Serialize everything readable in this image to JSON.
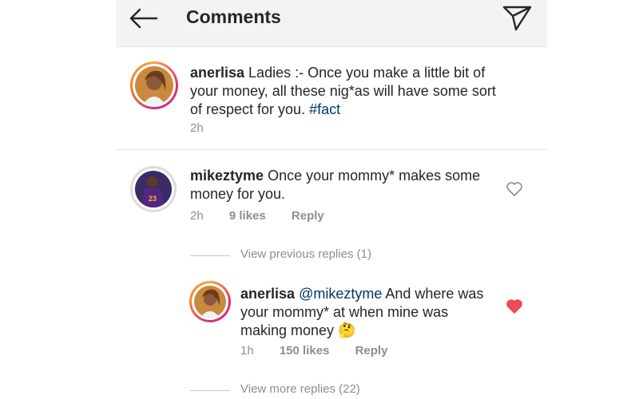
{
  "header": {
    "title": "Comments",
    "back_icon": "arrow-left-icon",
    "send_icon": "paper-plane-icon"
  },
  "caption": {
    "username": "anerlisa",
    "text_line1": " Ladies :- Once you make a little bit of",
    "text_line2": "your money, all these nig*as will have some sort",
    "text_line3_prefix": "of respect for you. ",
    "hashtag": "#fact",
    "time": "2h"
  },
  "comment1": {
    "username": "mikeztyme",
    "text_line1": " Once your mommy* makes some",
    "text_line2": "money for you.",
    "time": "2h",
    "likes": "9 likes",
    "reply": "Reply",
    "liked": false
  },
  "view_previous": "View previous replies (1)",
  "reply1": {
    "username": "anerlisa",
    "mention": "@mikeztyme",
    "text_line1": " And where was",
    "text_line2": "your mommy* at when mine was",
    "text_line3": "making money ",
    "emoji": "🤔",
    "time": "1h",
    "likes": "150 likes",
    "reply": "Reply",
    "liked": true
  },
  "view_more": "View more replies (22)",
  "colors": {
    "link": "#003569",
    "meta": "#8e8e8e",
    "heart_liked": "#ed4956",
    "header_bg": "#f3f3f3"
  }
}
